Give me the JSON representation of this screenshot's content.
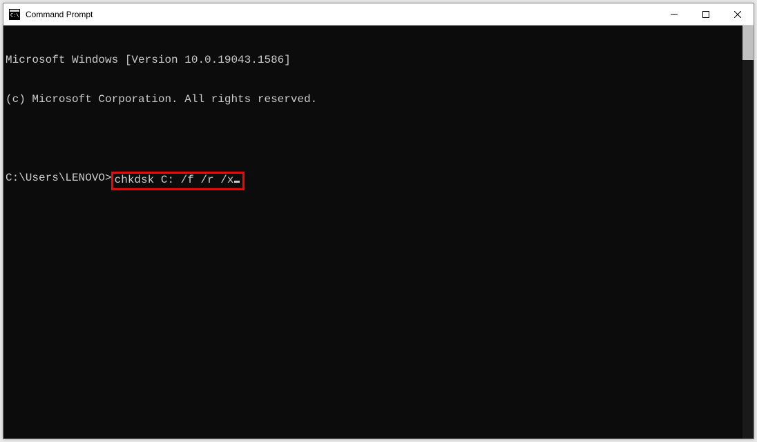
{
  "window": {
    "title": "Command Prompt"
  },
  "terminal": {
    "line1": "Microsoft Windows [Version 10.0.19043.1586]",
    "line2": "(c) Microsoft Corporation. All rights reserved.",
    "prompt": "C:\\Users\\LENOVO>",
    "command": "chkdsk C: /f /r /x"
  }
}
